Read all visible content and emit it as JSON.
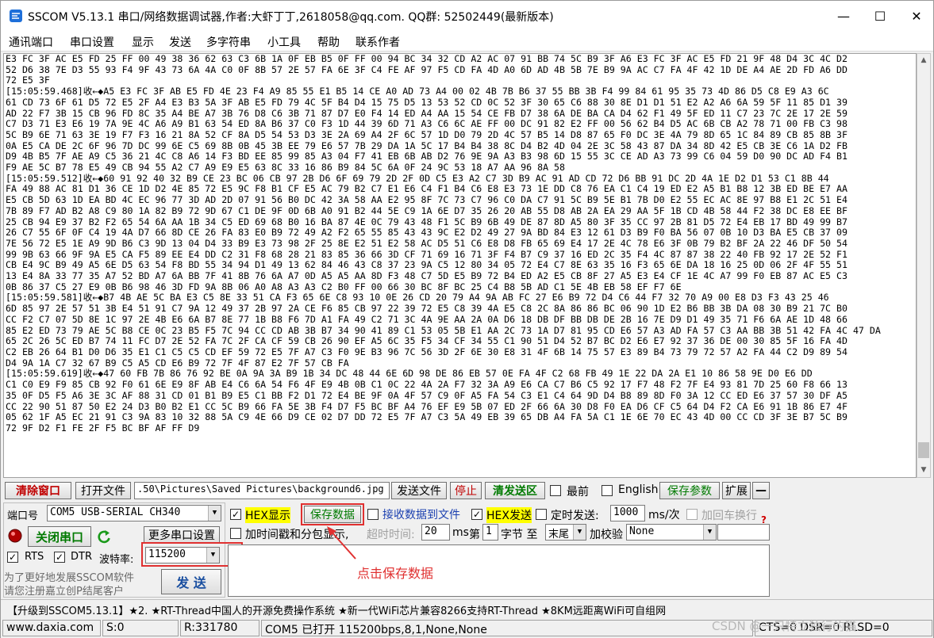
{
  "window": {
    "title": "SSCOM V5.13.1 串口/网络数据调试器,作者:大虾丁丁,2618058@qq.com. QQ群: 52502449(最新版本)",
    "minimize": "—",
    "maximize": "☐",
    "close": "✕"
  },
  "menu": [
    "通讯端口",
    "串口设置",
    "显示",
    "发送",
    "多字符串",
    "小工具",
    "帮助",
    "联系作者"
  ],
  "terminal_lines": [
    "E3 FC 3F AC E5 FD 25 FF 00 49 38 36 62 63 C3 6B 1A 0F EB B5 0F FF 00 94 BC 34 32 CD A2 AC 07 91 BB 74 5C B9 3F A6 E3 FC 3F AC E5 FD 21 9F 48 D4 3C 4C D2",
    "52 D6 38 7E D3 55 93 F4 9F 43 73 6A 4A C0 0F 8B 57 2E 57 FA 6E 3F C4 FE AF 97 F5 CD FA 4D A0 6D AD 4B 5B 7E B9 9A AC C7 FA 4F 42 1D DE A4 AE 2D FD A6 DD",
    "72 E5 3F",
    "[15:05:59.468]收←◆A5 E3 FC 3F AB E5 FD 4E 23 F4 A9 85 55 E1 B5 14 CE A0 AD 73 A4 00 02 4B 7B B6 37 55 BB 3B F4 99 84 61 95 35 73 4D 86 D5 C8 E9 A3 6C",
    "61 CD 73 6F 61 D5 72 E5 2F A4 E3 B3 5A 3F AB E5 FD 79 4C 5F B4 D4 15 75 D5 13 53 52 CD 0C 52 3F 30 65 C6 88 30 8E D1 D1 51 E2 A2 A6 6A 59 5F 11 85 D1 39",
    "AD 22 F7 3B 15 CB 96 FD 8C 35 A4 BE A7 3B 76 D8 C6 3B 71 87 D7 E0 F4 14 ED A4 AA 15 54 CE FB D7 38 6A DE BA CA D4 62 F1 49 5F ED 11 C7 23 7C 2E 17 2E 59",
    "C7 D3 71 E3 E6 19 7A 9E 4C A6 A9 B1 63 54 ED 8A B6 37 C0 F3 1D 44 39 6D 71 A3 C6 6C AE FF 00 DC 91 82 E2 FF 00 56 62 B4 D5 AC 6B CB A2 78 71 00 FB C3 98",
    "5C B9 6E 71 63 3E 19 F7 F3 16 21 8A 52 CF 8A D5 54 53 D3 3E 2A 69 A4 2F 6C 57 1D D0 79 2D 4C 57 B5 14 D8 87 65 F0 DC 3E 4A 79 8D 65 1C 84 89 CB 85 8B 3F",
    "0A E5 CA DE 2C 6F 96 7D DC 99 6E C5 69 8B 0B 45 3B EE 79 E6 57 7B 29 DA 1A 5C 17 B4 B4 38 8C D4 B2 4D 04 2E 3C 58 43 87 DA 34 8D 42 E5 CB 3E C6 1A D2 FB",
    "D9 4B B5 7F AE A9 C5 36 21 4C C8 A6 14 F3 BD EE 85 99 85 A3 04 F7 41 EB 6B AB D2 76 9E 9A A3 B3 98 6D 15 55 3C CE AD A3 73 99 C6 04 59 D0 90 DC AD F4 B1",
    "F9 AE 5C B7 78 E5 49 CB 94 55 A2 C7 A9 E9 E5 63 8C 33 16 86 B9 84 5C 6A 0F 24 9C 53 18 A7 AA 96 8A 58",
    "[15:05:59.512]收←◆60 91 92 40 32 B9 CE 23 BC 06 CB 97 2B D6 6F 69 79 2D 2F 0D C5 E3 A2 C7 3D B9 AC 91 AD CD 72 D6 BB 91 DC 2D 4A 1E D2 D1 53 C1 8B 44",
    "FA 49 88 AC 81 D1 36 CE 1D D2 4E 85 72 E5 9C F8 B1 CF E5 AC 79 B2 C7 E1 E6 C4 F1 B4 C6 E8 E3 73 1E DD C8 76 EA C1 C4 19 ED E2 A5 B1 B8 12 3B ED BE E7 AA",
    "E5 CB 5D 63 1D EA BD 4C EC 96 77 3D AD 2D 07 91 56 B0 DC 42 3A 58 AA E2 95 8F 7C 73 C7 96 C0 DA C7 91 5C B9 5E B1 7B D0 E2 55 EC AC 8E 97 B8 E1 2C 51 E4",
    "7B 89 F7 AD B2 A8 C9 80 1A 82 B9 72 9D 67 C1 DE 9F 0D 6B A0 91 B2 44 5E C9 1A 6E D7 35 26 20 AB 55 D8 AB 2A EA 29 AA 5F 1B CD 4B 58 44 F2 38 DC E8 EE BF",
    "25 CB 94 E9 37 B2 F2 65 54 6A AA 1B 34 C5 ED 69 68 B0 16 BA 87 4E 0C 79 43 48 F1 5C B9 6B 49 DE 87 8D A5 80 3F 35 CC 97 2B 81 D5 72 E4 EB 17 BD 49 99 B7",
    "26 C7 55 6F 0F C4 19 4A D7 66 8D CE 26 FA 83 E0 B9 72 49 A2 F2 65 55 85 43 43 9C E2 D2 49 27 9A BD 84 E3 12 61 D3 B9 F0 BA 56 07 0B 10 D3 BA E5 CB 37 09",
    "7E 56 72 E5 1E A9 9D B6 C3 9D 13 04 D4 33 B9 E3 73 98 2F 25 8E E2 51 E2 58 AC D5 51 C6 E8 D8 FB 65 69 E4 17 2E 4C 78 E6 3F 0B 79 B2 BF 2A 22 46 DF 50 54",
    "99 9B 63 66 9F 9A E5 CA F5 89 EE E4 DD C2 31 F8 68 28 21 83 85 36 66 3D CF 71 69 16 71 3F F4 B7 C9 37 16 ED 2C 35 F4 4C 87 87 38 22 40 FB 92 17 2E 52 F1",
    "CB E4 9C B9 49 A5 6E D5 63 54 F8 BD 55 34 94 D1 49 13 62 84 46 43 C8 37 23 9A C5 12 80 34 05 72 E4 C7 8E 63 35 16 F3 65 6E DA 18 16 25 0D 06 2F 4F 55 51",
    "13 E4 8A 33 77 35 A7 52 BD A7 6A BB 7F 41 8B 76 6A A7 0D A5 A5 AA 8D F3 48 C7 5D E5 B9 72 B4 ED A2 E5 CB 8F 27 A5 E3 E4 CF 1E 4C A7 99 F0 EB 87 AC E5 C3",
    "0B 86 37 C5 27 E9 0B B6 98 46 3D FD 9A 8B 06 A0 A8 A3 A3 C2 B0 FF 00 66 30 BC 8F BC 25 C4 B8 5B AD C1 5E 4B EB 58 EF F7 6E",
    "[15:05:59.581]收←◆B7 4B AE 5C BA E3 C5 8E 33 51 CA F3 65 6E C8 93 10 0E 26 CD 20 79 A4 9A AB FC 27 E6 B9 72 D4 C6 44 F7 32 70 A9 00 E8 D3 F3 43 25 46",
    "6D 85 97 2E 57 51 3B E4 51 91 C7 9A 12 49 37 2B 97 2A CE F6 85 CB 97 22 39 72 E5 C8 39 4A E5 C8 2C 8A 86 86 BC 06 90 1D E2 B6 BB 3B DA 08 30 B9 21 7C B0",
    "CC F2 C7 07 5D 8E 1C 97 2E 4B E6 6A B7 8E 77 1B B8 F6 7D A1 FA 49 C2 71 3C 4A 9E AA 2A 0A D6 18 DB DF BB DB DE 2B 16 7E D9 D1 49 35 71 F6 6A AE 1D 48 66",
    "85 E2 ED 73 79 AE 5C B8 CE 0C 23 B5 F5 7C 94 CC CD AB 3B B7 34 90 41 89 C1 53 05 5B E1 AA 2C 73 1A D7 81 95 CD E6 57 A3 AD FA 57 C3 AA BB 3B 51 42 FA 4C 47 DA",
    "65 2C 26 5C ED B7 74 11 FC D7 2E 52 FA 7C 2F CA CF 59 CB 26 90 EF A5 6C 35 F5 34 CF 34 55 C1 90 51 D4 52 B7 BC D2 E6 E7 92 37 36 DE 00 30 85 5F 16 FA 4D",
    "C2 EB 26 64 B1 D0 D6 35 E1 C1 C5 C5 CD EF 59 72 E5 7F A7 C3 F0 9E B3 96 7C 56 3D 2F 6E 30 E8 31 4F 6B 14 75 57 E3 89 B4 73 79 72 57 A2 FA 44 C2 D9 89 54",
    "D4 9A 1A C7 32 67 B9 C5 A5 CD E6 B9 72 7F 4F 87 E2 7F 57 CB FA",
    "[15:05:59.619]收←◆47 60 FB 7B 86 76 92 BE 0A 9A 3A B9 1B 34 DC 48 44 6E 6D 98 DE 86 EB 57 0E FA 4F C2 68 FB 49 1E 22 DA 2A E1 10 86 58 9E D0 E6 DD",
    "C1 C0 E9 F9 85 CB 92 F0 61 6E E9 8F AB E4 C6 6A 54 F6 4F E9 4B 0B C1 0C 22 4A 2A F7 32 3A A9 E6 CA C7 B6 C5 92 17 F7 48 F2 7F E4 93 81 7D 25 60 F8 66 13",
    "35 0F D5 F5 A6 3E 3C AF 88 31 CD 01 B1 B9 E5 C1 BB F2 D1 72 E4 BE 9F 0A 4F 57 C9 0F A5 FA 54 C3 E1 C4 64 9D D4 B8 89 8D F0 3A 12 CC ED E6 37 57 30 DF A5",
    "CC 22 90 51 87 50 E2 24 D3 B0 B2 E1 CC 5C B9 66 FA 5E 3B F4 D7 F5 BC BF A4 76 EF E9 5B 07 ED 2F 66 6A 30 D8 F0 EA D6 CF C5 64 D4 F2 CA E6 91 1B 86 E7 4F",
    "05 62 1F A5 EC 21 91 C3 9A 83 10 32 88 5A C9 4E 66 D9 CE 02 D7 DD 72 E5 7F A7 C3 5A 49 EB 39 65 DB A4 FA 5A C1 1E 6E 70 EC 43 4D 00 CC CD 3F 3E B7 5C B9",
    "72 9F D2 F1 FE 2F F5 BC BF AF FF D9"
  ],
  "toolbar": {
    "clear_window": "清除窗口",
    "open_file": "打开文件",
    "file_path": ".50\\Pictures\\Saved Pictures\\background6.jpg",
    "send_file": "发送文件",
    "stop": "停止",
    "clear_send_area": "清发送区",
    "topmost_label": "最前",
    "english_label": "English",
    "save_params": "保存参数",
    "expand": "扩展",
    "collapse": "—"
  },
  "port_panel": {
    "port_label": "端口号",
    "port_value": "COM5 USB-SERIAL CH340",
    "close_port": "关闭串口",
    "more_settings": "更多串口设置",
    "rts_label": "RTS",
    "dtr_label": "DTR",
    "baud_label": "波特率:",
    "baud_value": "115200",
    "promo_line1": "为了更好地发展SSCOM软件",
    "promo_line2": "请您注册嘉立创P结尾客户"
  },
  "options": {
    "hex_display": "HEX显示",
    "save_data": "保存数据",
    "recv_to_file": "接收数据到文件",
    "hex_send": "HEX发送",
    "timed_send": "定时发送:",
    "timed_value": "1000",
    "timed_unit": "ms/次",
    "add_newline": "加回车换行",
    "add_timestamp": "加时间戳和分包显示,",
    "timeout_label": "超时时间:",
    "timeout_value": "20",
    "timeout_unit": "ms",
    "nth_label": "第",
    "nth_value": "1",
    "byte_label": "字节 至",
    "end_value": "末尾",
    "checksum_label": "加校验",
    "checksum_value": "None",
    "help_mark": "?",
    "send_button": "发 送"
  },
  "annotation": "点击保存数据",
  "ticker": "【升级到SSCOM5.13.1】★2. ★RT-Thread中国人的开源免费操作系统 ★新一代WiFi芯片兼容8266支持RT-Thread ★8KM远距离WiFi可自组网",
  "status": {
    "website": "www.daxia.com",
    "sent": "S:0",
    "received": "R:331780",
    "port_status": "COM5 已打开  115200bps,8,1,None,None",
    "signals": "CTS=0 DSR=0 RLSD=0"
  },
  "watermark": "CSDN @一只特立独行的猫",
  "colors": {
    "highlight_yellow": "#ffff00",
    "annotation_red": "#e03030",
    "button_red_text": "#c00000",
    "button_green_text": "#007a00"
  }
}
